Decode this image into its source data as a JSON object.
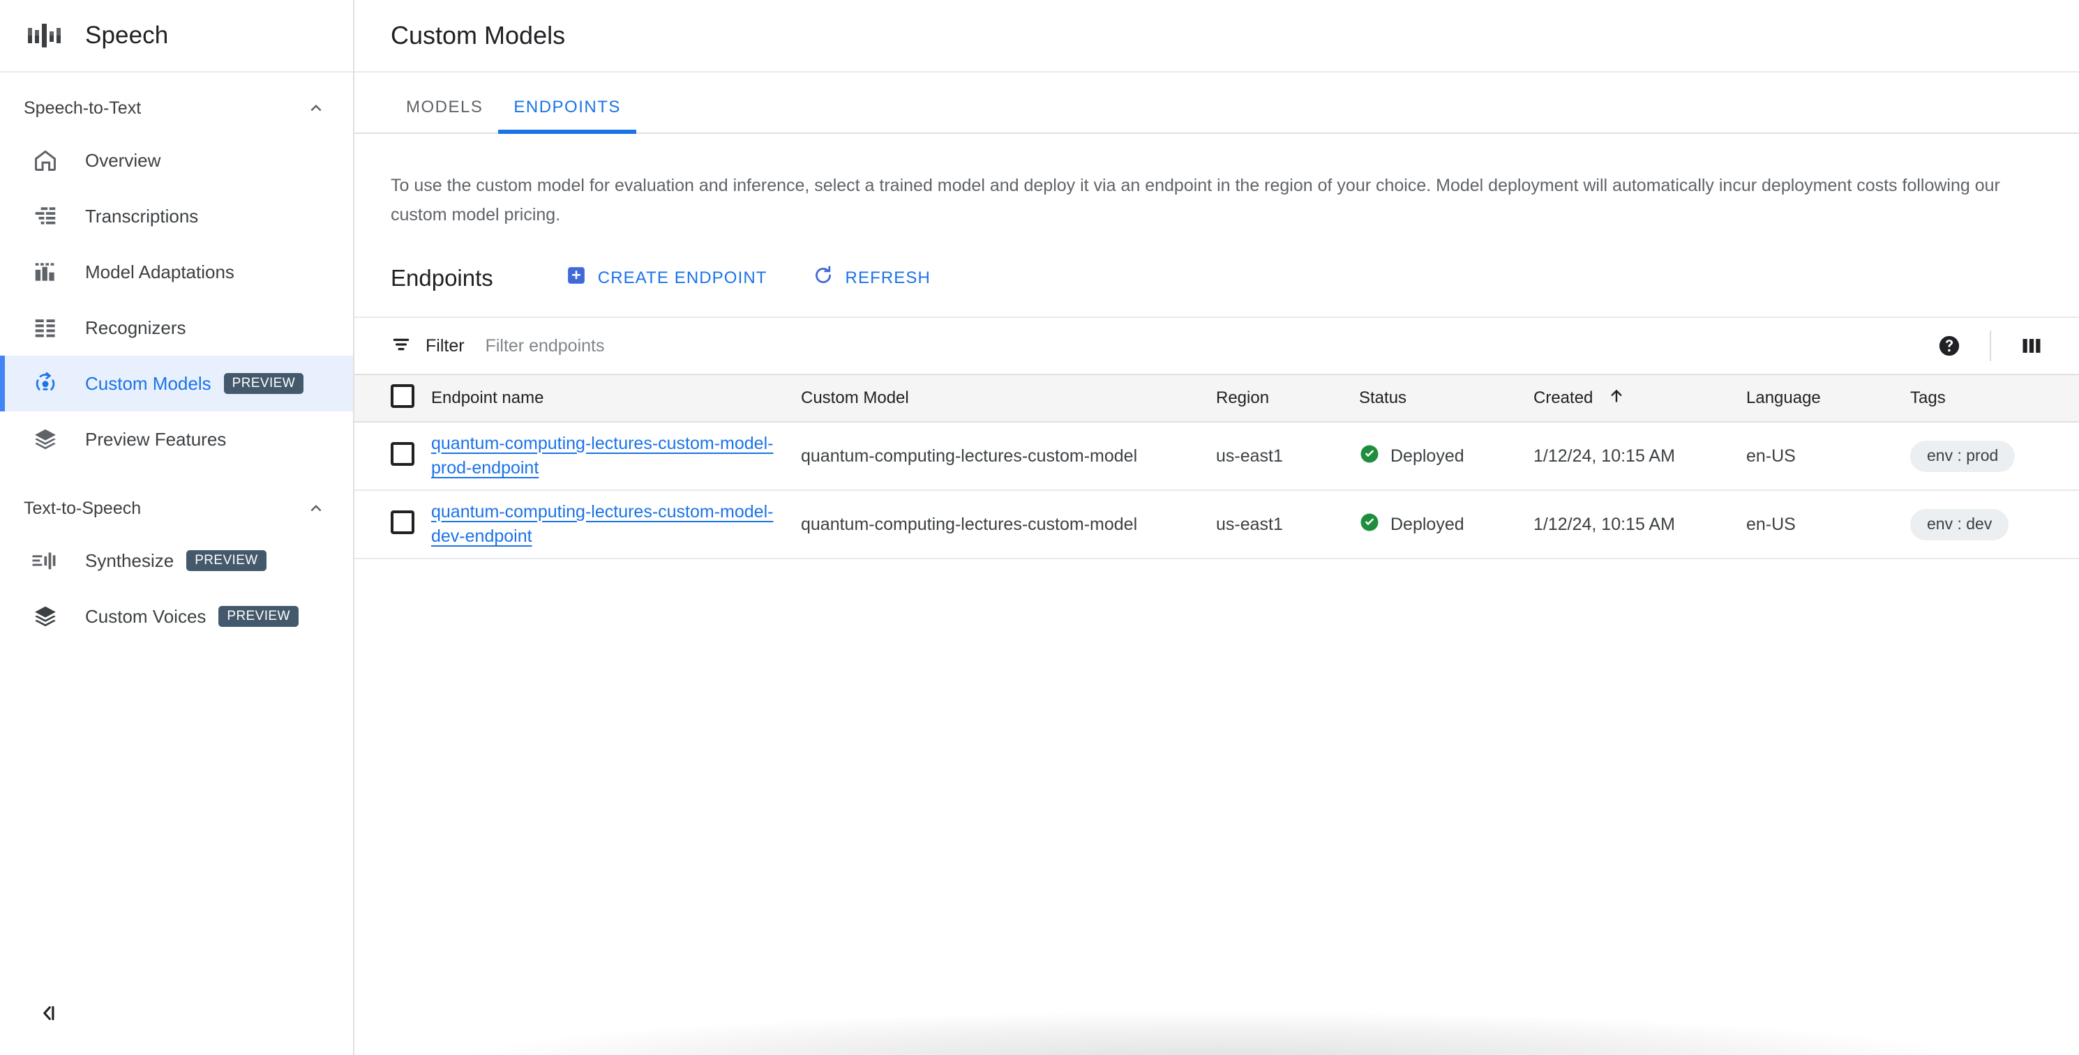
{
  "brand": {
    "title": "Speech",
    "icon": "speech-waveform-icon"
  },
  "sidebar": {
    "sections": [
      {
        "title": "Speech-to-Text",
        "collapse_icon": "chevron-up-icon",
        "items": [
          {
            "label": "Overview",
            "icon": "home-icon",
            "badge": null,
            "active": false
          },
          {
            "label": "Transcriptions",
            "icon": "transcription-icon",
            "badge": null,
            "active": false
          },
          {
            "label": "Model Adaptations",
            "icon": "bar-chart-icon",
            "badge": null,
            "active": false
          },
          {
            "label": "Recognizers",
            "icon": "list-grid-icon",
            "badge": null,
            "active": false
          },
          {
            "label": "Custom Models",
            "icon": "lightbulb-refresh-icon",
            "badge": "PREVIEW",
            "active": true
          },
          {
            "label": "Preview Features",
            "icon": "layers-icon",
            "badge": null,
            "active": false
          }
        ]
      },
      {
        "title": "Text-to-Speech",
        "collapse_icon": "chevron-up-icon",
        "items": [
          {
            "label": "Synthesize",
            "icon": "synthesize-waveform-icon",
            "badge": "PREVIEW",
            "active": false
          },
          {
            "label": "Custom Voices",
            "icon": "layers-icon",
            "badge": "PREVIEW",
            "active": false
          }
        ]
      }
    ],
    "collapse_button_icon": "collapse-panel-icon"
  },
  "header": {
    "title": "Custom Models"
  },
  "tabs": [
    {
      "label": "MODELS",
      "active": false
    },
    {
      "label": "ENDPOINTS",
      "active": true
    }
  ],
  "content": {
    "description": "To use the custom model for evaluation and inference, select a trained model and deploy it via an endpoint in the region of your choice. Model deployment will automatically incur deployment costs following our custom model pricing.",
    "section_title": "Endpoints",
    "create_button": {
      "label": "CREATE ENDPOINT",
      "icon": "add-box-icon"
    },
    "refresh_button": {
      "label": "REFRESH",
      "icon": "refresh-icon"
    }
  },
  "filter": {
    "label": "Filter",
    "icon": "filter-icon",
    "placeholder": "Filter endpoints",
    "value": "",
    "help_icon": "help-circle-icon",
    "columns_icon": "column-settings-icon"
  },
  "table": {
    "columns": [
      {
        "key": "checkbox",
        "label": ""
      },
      {
        "key": "name",
        "label": "Endpoint name"
      },
      {
        "key": "model",
        "label": "Custom Model"
      },
      {
        "key": "region",
        "label": "Region"
      },
      {
        "key": "status",
        "label": "Status"
      },
      {
        "key": "created",
        "label": "Created",
        "sorted": "asc",
        "sort_icon": "arrow-up-icon"
      },
      {
        "key": "language",
        "label": "Language"
      },
      {
        "key": "tags",
        "label": "Tags"
      }
    ],
    "rows": [
      {
        "checked": false,
        "name": "quantum-computing-lectures-custom-model-prod-endpoint",
        "model": "quantum-computing-lectures-custom-model",
        "region": "us-east1",
        "status": "Deployed",
        "status_icon": "check-circle-icon",
        "created": "1/12/24, 10:15 AM",
        "language": "en-US",
        "tags": "env : prod"
      },
      {
        "checked": false,
        "name": "quantum-computing-lectures-custom-model-dev-endpoint",
        "model": "quantum-computing-lectures-custom-model",
        "region": "us-east1",
        "status": "Deployed",
        "status_icon": "check-circle-icon",
        "created": "1/12/24, 10:15 AM",
        "language": "en-US",
        "tags": "env : dev"
      }
    ]
  },
  "colors": {
    "accent_blue": "#1a73e8",
    "active_nav_bg": "#e8f0fe",
    "status_green": "#1e8e3e",
    "preview_chip_bg": "#44596b",
    "tag_chip_bg": "#eceff1",
    "table_header_bg": "#f5f5f5"
  }
}
